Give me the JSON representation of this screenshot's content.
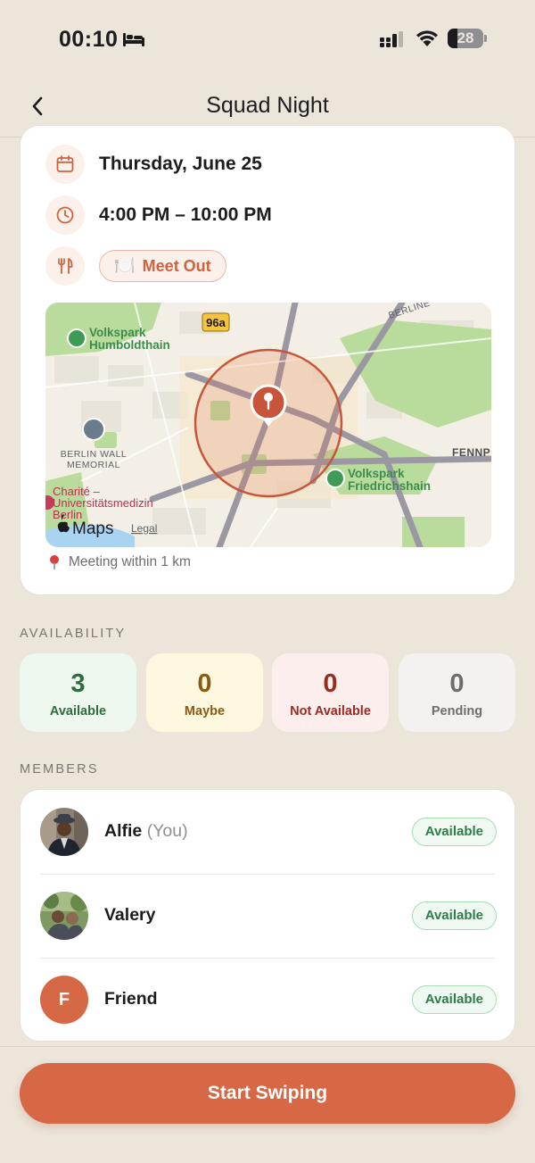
{
  "status_bar": {
    "time": "00:10",
    "battery_level": "28",
    "battery_fraction": 0.28
  },
  "nav": {
    "title": "Squad Night"
  },
  "details": {
    "date": "Thursday, June 25",
    "time_range": "4:00 PM – 10:00 PM",
    "meet_type": "Meet Out",
    "meet_emoji": "🍽️",
    "meeting_radius": "Meeting within 1 km"
  },
  "map": {
    "labels": {
      "road_badge": "96a",
      "park1_line1": "Volkspark",
      "park1_line2": "Humboldthain",
      "memorial_line1": "BERLIN WALL",
      "memorial_line2": "MEMORIAL",
      "hospital_line1": "Charité –",
      "hospital_line2": "Universitätsmedizin",
      "hospital_line3": "Berlin",
      "park2_line1": "Volkspark",
      "park2_line2": "Friedrichshain",
      "district": "FENNP",
      "street": "BERLINE",
      "maps_brand": "Maps",
      "legal": "Legal"
    }
  },
  "availability": {
    "title": "AVAILABILITY",
    "available": {
      "count": "3",
      "label": "Available"
    },
    "maybe": {
      "count": "0",
      "label": "Maybe"
    },
    "not_available": {
      "count": "0",
      "label": "Not Available"
    },
    "pending": {
      "count": "0",
      "label": "Pending"
    }
  },
  "members": {
    "title": "MEMBERS",
    "list": [
      {
        "name": "Alfie",
        "suffix": "(You)",
        "status": "Available"
      },
      {
        "name": "Valery",
        "status": "Available"
      },
      {
        "name": "Friend",
        "initial": "F",
        "status": "Available"
      }
    ]
  },
  "cta": {
    "label": "Start Swiping"
  },
  "colors": {
    "accent": "#D66845",
    "background": "#ECE5DA",
    "available": "#2E7D47"
  }
}
